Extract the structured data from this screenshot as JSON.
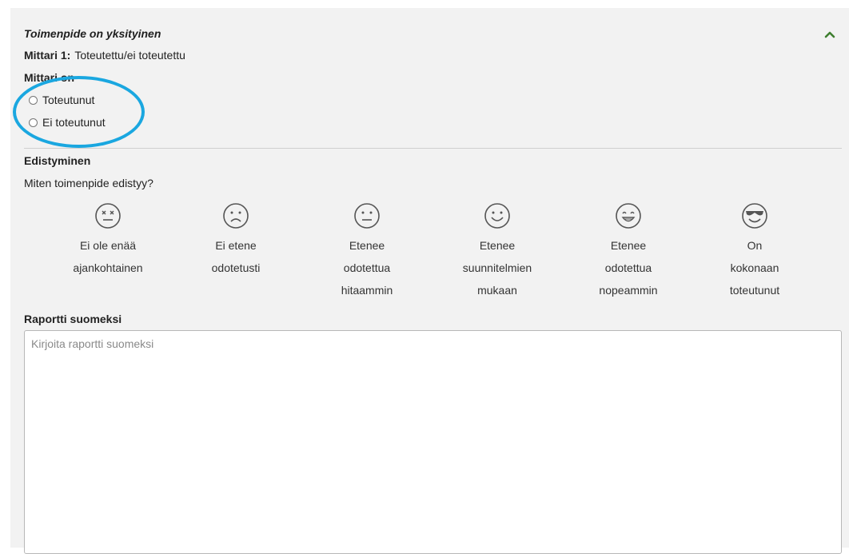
{
  "section": {
    "title": "Toimenpide on yksityinen",
    "mittari_label": "Mittari 1:",
    "mittari_value": "Toteutettu/ei toteutettu",
    "mittari_on_label": "Mittari on"
  },
  "radios": [
    {
      "label": "Toteutunut",
      "checked": false
    },
    {
      "label": "Ei toteutunut",
      "checked": false
    }
  ],
  "progress": {
    "heading": "Edistyminen",
    "question": "Miten toimenpide edistyy?",
    "options": [
      {
        "icon": "dizzy-face-icon",
        "label": "Ei ole enää\najankohtainen"
      },
      {
        "icon": "frown-face-icon",
        "label": "Ei etene\nodotetusti"
      },
      {
        "icon": "neutral-face-icon",
        "label": "Etenee\nodotettua\nhitaammin"
      },
      {
        "icon": "smile-face-icon",
        "label": "Etenee\nsuunnitelmien\nmukaan"
      },
      {
        "icon": "grin-face-icon",
        "label": "Etenee\nodotettua\nnopeammin"
      },
      {
        "icon": "sunglasses-face-icon",
        "label": "On\nkokonaan\ntoteutunut"
      }
    ]
  },
  "report": {
    "heading": "Raportti suomeksi",
    "placeholder": "Kirjoita raportti suomeksi",
    "value": ""
  },
  "colors": {
    "accent_green": "#3f7f2f",
    "annotation_blue": "#1aa7e0",
    "panel_bg": "#f2f2f2"
  }
}
